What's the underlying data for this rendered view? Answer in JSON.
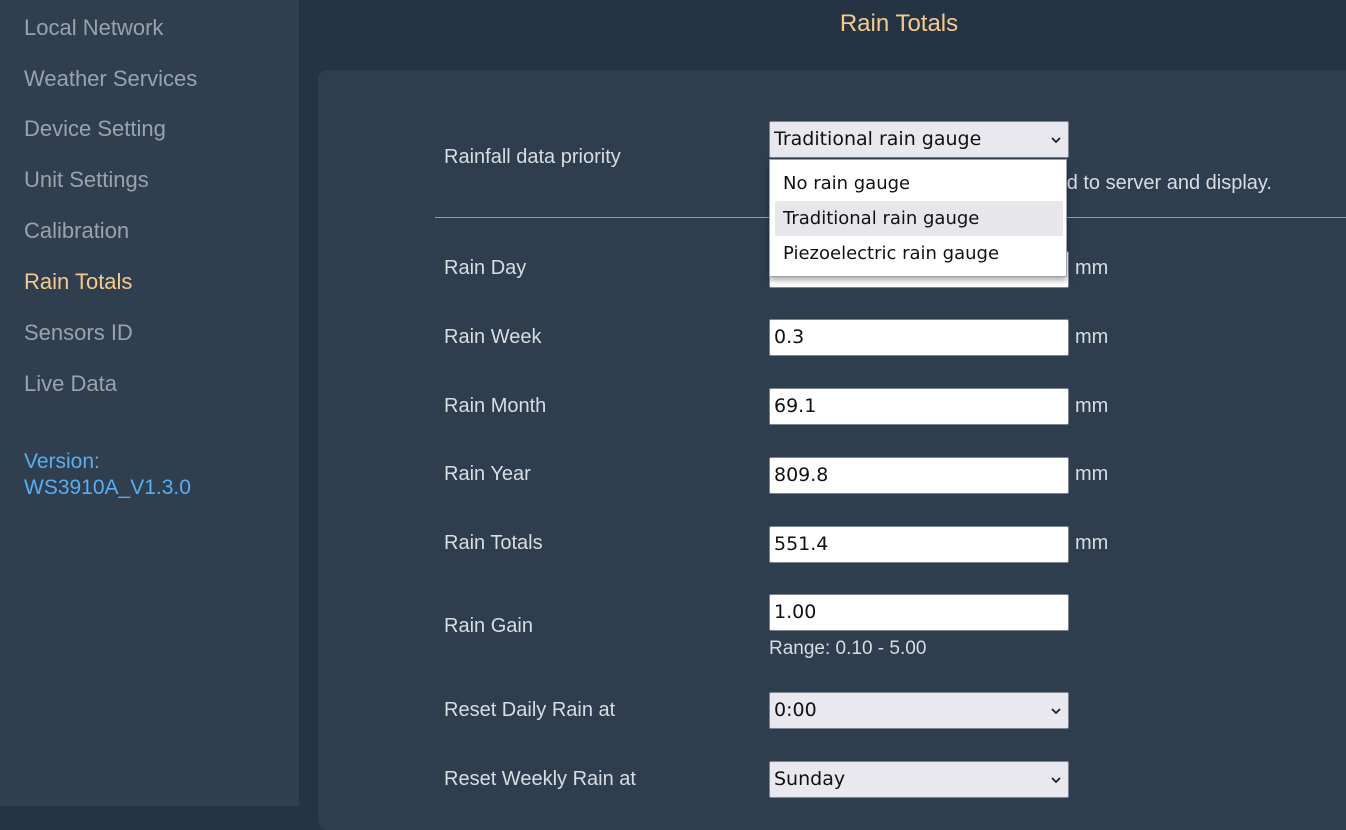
{
  "sidebar": {
    "items": [
      {
        "label": "Local Network"
      },
      {
        "label": "Weather Services"
      },
      {
        "label": "Device Setting"
      },
      {
        "label": "Unit Settings"
      },
      {
        "label": "Calibration"
      },
      {
        "label": "Rain Totals"
      },
      {
        "label": "Sensors ID"
      },
      {
        "label": "Live Data"
      }
    ],
    "active_index": 5,
    "version_label": "Version:",
    "version_value": "WS3910A_V1.3.0"
  },
  "page": {
    "title": "Rain Totals"
  },
  "priority": {
    "label": "Rainfall data priority",
    "selected": "Traditional rain gauge",
    "description": "load to server and display.",
    "options": [
      "No rain gauge",
      "Traditional rain gauge",
      "Piezoelectric rain gauge"
    ],
    "highlighted_index": 1
  },
  "fields": {
    "rain_day": {
      "label": "Rain Day",
      "value": "",
      "unit": "mm"
    },
    "rain_week": {
      "label": "Rain Week",
      "value": "0.3",
      "unit": "mm"
    },
    "rain_month": {
      "label": "Rain Month",
      "value": "69.1",
      "unit": "mm"
    },
    "rain_year": {
      "label": "Rain Year",
      "value": "809.8",
      "unit": "mm"
    },
    "rain_totals": {
      "label": "Rain Totals",
      "value": "551.4",
      "unit": "mm"
    },
    "rain_gain": {
      "label": "Rain Gain",
      "value": "1.00",
      "range": "Range: 0.10 - 5.00"
    }
  },
  "resets": {
    "daily": {
      "label": "Reset Daily Rain at",
      "value": "0:00"
    },
    "weekly": {
      "label": "Reset Weekly Rain at",
      "value": "Sunday"
    }
  },
  "colors": {
    "accent": "#f7c98a",
    "version": "#5aaef0",
    "divider": "#6aa9dc"
  }
}
